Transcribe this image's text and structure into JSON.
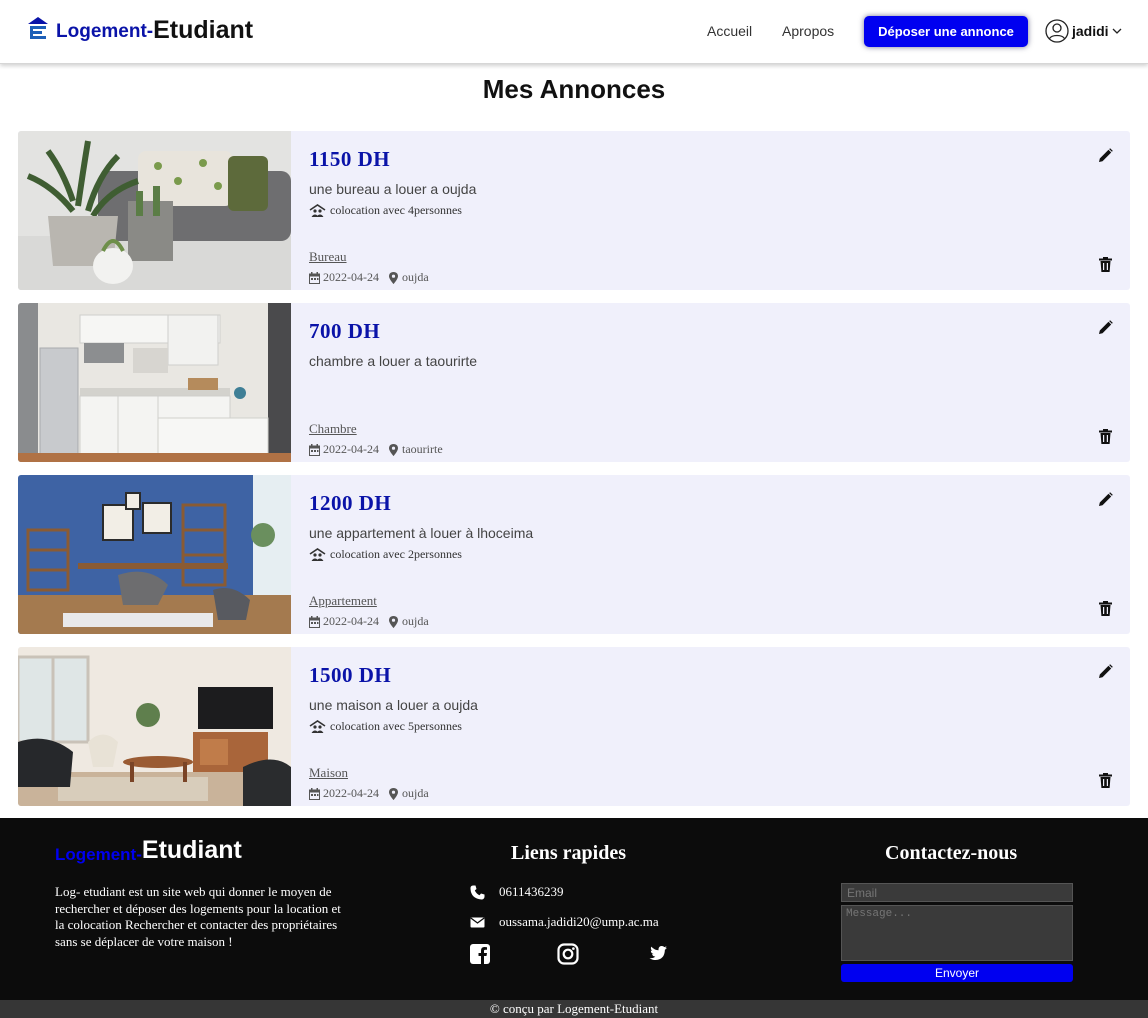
{
  "header": {
    "logo_part1": "Logement-",
    "logo_part2": "Etudiant",
    "nav": {
      "home": "Accueil",
      "about": "Apropos"
    },
    "cta": "Déposer une annonce",
    "username": "jadidi",
    "icons": [
      "building-icon",
      "user-circle-icon",
      "chevron-down-icon"
    ],
    "colors": {
      "brand_blue": "#0a13a8",
      "cta_blue": "#0000f0"
    }
  },
  "page": {
    "title": "Mes Annonces"
  },
  "listings": [
    {
      "price": "1150 DH",
      "title": "une bureau a louer a oujda",
      "coloc": "colocation avec 4personnes",
      "category": "Bureau",
      "date": "2022-04-24",
      "city": "oujda"
    },
    {
      "price": "700 DH",
      "title": "chambre a louer a taourirte",
      "coloc": "",
      "category": "Chambre",
      "date": "2022-04-24",
      "city": "taourirte"
    },
    {
      "price": "1200 DH",
      "title": "une appartement à louer à lhoceima",
      "coloc": "colocation avec 2personnes",
      "category": "Appartement",
      "date": "2022-04-24",
      "city": "oujda"
    },
    {
      "price": "1500 DH",
      "title": "une maison a louer a oujda",
      "coloc": "colocation avec 5personnes",
      "category": "Maison",
      "date": "2022-04-24",
      "city": "oujda"
    }
  ],
  "footer": {
    "logo_part1": "Logement-",
    "logo_part2": "Etudiant",
    "description": "Log- etudiant est un site web qui donner le moyen de rechercher et déposer des logements pour la location et la colocation Rechercher et contacter des propriétaires sans se déplacer de votre maison !",
    "links_heading": "Liens rapides",
    "phone": "0611436239",
    "email": "oussama.jadidi20@ump.ac.ma",
    "contact_heading": "Contactez-nous",
    "email_placeholder": "Email",
    "message_placeholder": "Message...",
    "send_label": "Envoyer",
    "copyright": "© conçu par Logement-Etudiant",
    "social_icons": [
      "facebook-icon",
      "instagram-icon",
      "twitter-icon"
    ]
  }
}
